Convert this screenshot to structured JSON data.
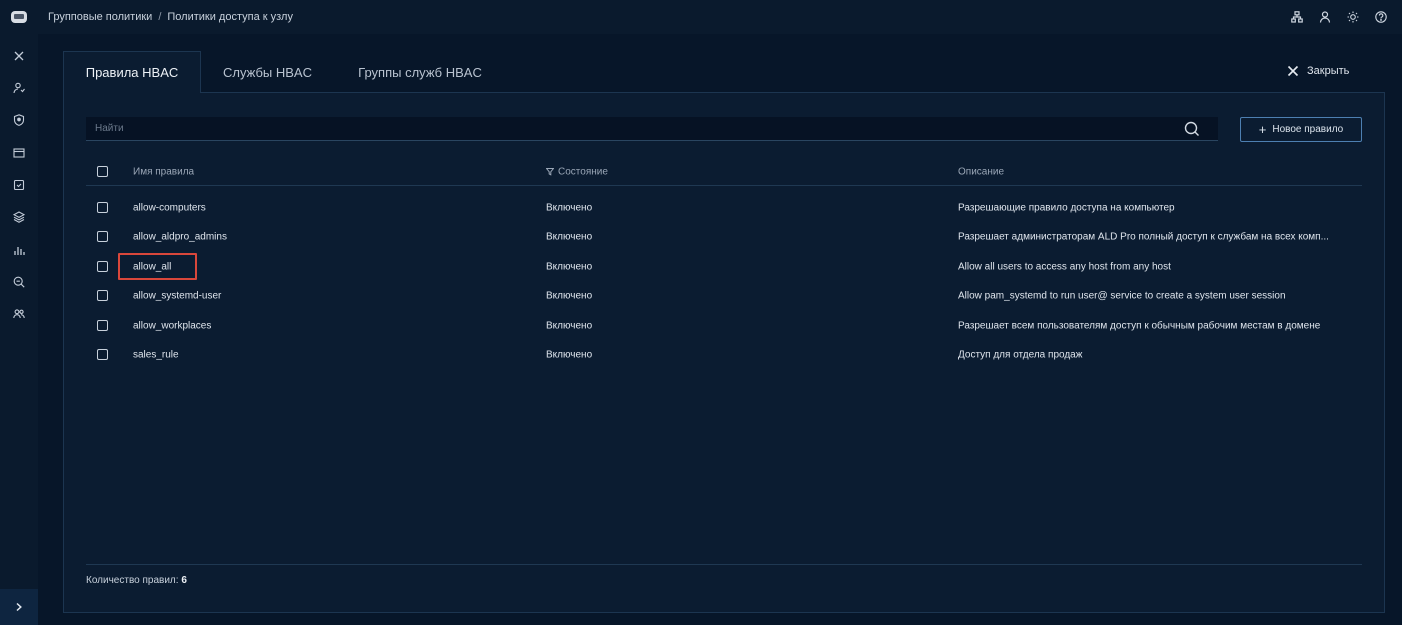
{
  "breadcrumb": {
    "parent": "Групповые политики",
    "separator": "/",
    "current": "Политики доступа к узлу"
  },
  "tabs": [
    {
      "label": "Правила HBAC"
    },
    {
      "label": "Службы HBAC"
    },
    {
      "label": "Группы служб HBAC"
    }
  ],
  "close_label": "Закрыть",
  "search": {
    "placeholder": "Найти",
    "value": ""
  },
  "new_rule_label": "Новое правило",
  "columns": {
    "name": "Имя правила",
    "state": "Состояние",
    "description": "Описание"
  },
  "rows": [
    {
      "name": "allow-computers",
      "state": "Включено",
      "description": "Разрешающие правило доступа на компьютер"
    },
    {
      "name": "allow_aldpro_admins",
      "state": "Включено",
      "description": "Разрешает администраторам ALD Pro полный доступ к службам на всех комп..."
    },
    {
      "name": "allow_all",
      "state": "Включено",
      "description": "Allow all users to access any host from any host"
    },
    {
      "name": "allow_systemd-user",
      "state": "Включено",
      "description": "Allow pam_systemd to run user@ service to create a system user session"
    },
    {
      "name": "allow_workplaces",
      "state": "Включено",
      "description": "Разрешает всем пользователям доступ к обычным рабочим местам в домене"
    },
    {
      "name": "sales_rule",
      "state": "Включено",
      "description": "Доступ для отдела продаж"
    }
  ],
  "footer": {
    "label": "Количество правил:",
    "count": "6"
  },
  "colors": {
    "background": "#071629",
    "panel": "#0b1c31",
    "accent_border": "#4d7fb1",
    "highlight": "#d9473b"
  },
  "icons": {
    "top": [
      "network-icon",
      "user-icon",
      "theme-sun-icon",
      "help-icon"
    ],
    "sidebar": [
      "tools-icon",
      "users-icon",
      "shield-icon",
      "card-icon",
      "document-icon",
      "layers-icon",
      "chart-icon",
      "search-zoom-icon",
      "groups-icon"
    ]
  }
}
